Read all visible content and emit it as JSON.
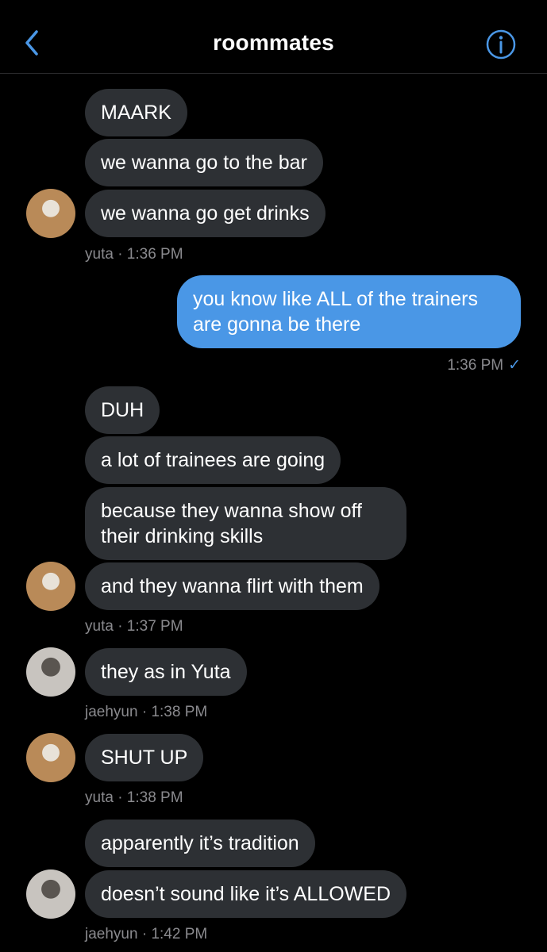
{
  "header": {
    "title": "roommates"
  },
  "messages": [
    {
      "text": "MAARK"
    },
    {
      "text": "we wanna go to the bar"
    },
    {
      "text": "we wanna go get drinks"
    },
    {
      "meta": "yuta · 1:36 PM"
    },
    {
      "text": "you know like ALL of the trainers are gonna be there"
    },
    {
      "meta": "1:36 PM",
      "check": "✓"
    },
    {
      "text": "DUH"
    },
    {
      "text": "a lot of trainees are going"
    },
    {
      "text": "because they wanna show off their drinking skills"
    },
    {
      "text": "and they wanna flirt with them"
    },
    {
      "meta": "yuta · 1:37 PM"
    },
    {
      "text": "they as in Yuta"
    },
    {
      "meta": "jaehyun · 1:38 PM"
    },
    {
      "text": "SHUT UP"
    },
    {
      "meta": "yuta · 1:38 PM"
    },
    {
      "text": "apparently it’s tradition"
    },
    {
      "text": "doesn’t sound like it’s ALLOWED"
    },
    {
      "meta": "jaehyun · 1:42 PM"
    }
  ],
  "colors": {
    "background": "#000000",
    "incoming_bubble": "#2d3034",
    "outgoing_bubble": "#4a97e6",
    "accent": "#4a97e6",
    "meta_text": "#8a8a8e"
  },
  "icons": {
    "back": "chevron-left-icon",
    "info": "info-circle-icon"
  }
}
